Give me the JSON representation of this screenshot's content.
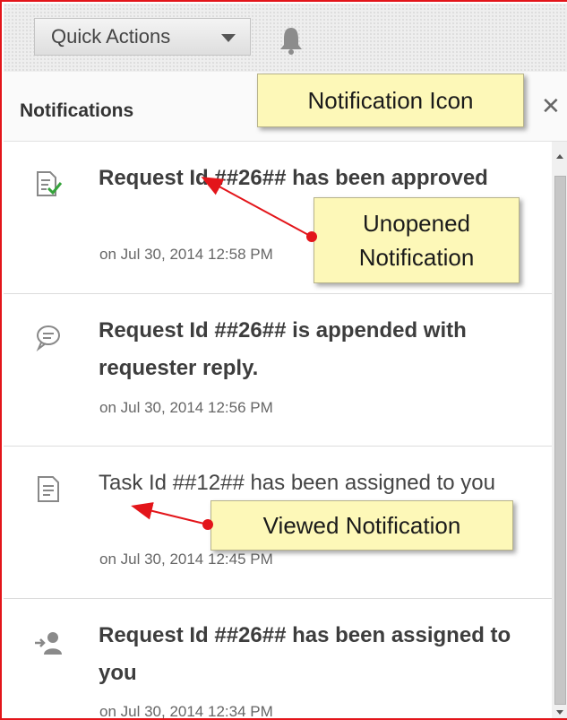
{
  "toolbar": {
    "quick_actions_label": "Quick Actions",
    "bell_icon": "bell-icon"
  },
  "panel": {
    "title": "Notifications",
    "close_symbol": "✕"
  },
  "notifications": [
    {
      "icon": "approved-document-icon",
      "message": "Request Id ##26## has been approved",
      "timestamp": "on Jul 30, 2014 12:58 PM",
      "unread": true
    },
    {
      "icon": "chat-bubble-icon",
      "message": "Request Id ##26## is appended with requester reply.",
      "timestamp": "on Jul 30, 2014 12:56 PM",
      "unread": true
    },
    {
      "icon": "document-icon",
      "message": "Task Id ##12## has been assigned to you",
      "timestamp": "on Jul 30, 2014 12:45 PM",
      "unread": false
    },
    {
      "icon": "assign-user-icon",
      "message": "Request Id ##26## has been assigned to you",
      "timestamp": "on Jul 30, 2014 12:34 PM",
      "unread": true
    }
  ],
  "annotations": {
    "notification_icon": "Notification Icon",
    "unopened_line1": "Unopened",
    "unopened_line2": "Notification",
    "viewed": "Viewed Notification"
  },
  "colors": {
    "frame_border": "#e3151a",
    "callout_bg": "#fdf8b8",
    "arrow": "#e3151a"
  }
}
